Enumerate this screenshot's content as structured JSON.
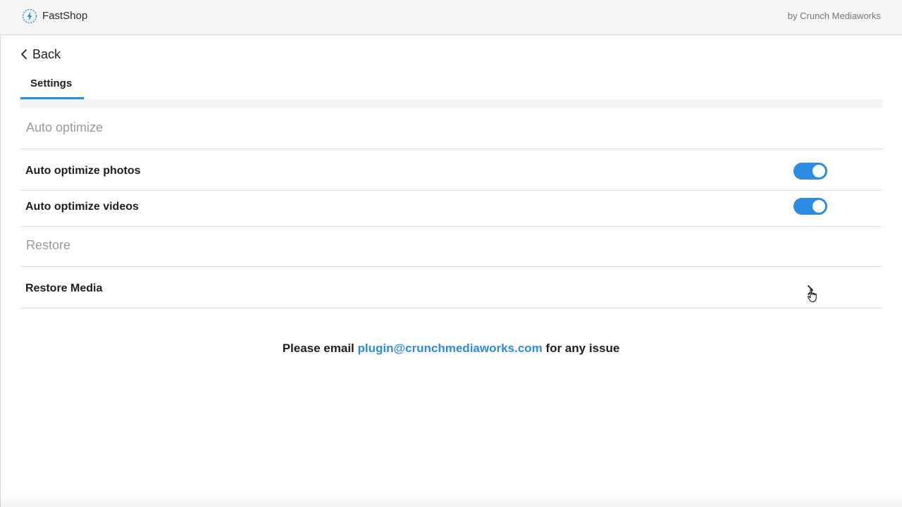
{
  "app": {
    "name": "FastShop",
    "vendor": "by Crunch Mediaworks",
    "accent_color": "#2c8be2",
    "logo_icon": "lightning-bolt-icon"
  },
  "nav": {
    "back_label": "Back",
    "back_icon": "chevron-left-icon"
  },
  "tabs": [
    {
      "label": "Settings",
      "active": true
    }
  ],
  "sections": {
    "auto_optimize": {
      "title": "Auto optimize",
      "rows": [
        {
          "label": "Auto optimize photos",
          "toggle_on": true
        },
        {
          "label": "Auto optimize videos",
          "toggle_on": true
        }
      ]
    },
    "restore": {
      "title": "Restore",
      "rows": [
        {
          "label": "Restore Media",
          "icon": "chevron-right-icon"
        }
      ]
    }
  },
  "footer": {
    "prefix": "Please email",
    "email": "plugin@crunchmediaworks.com",
    "suffix": "for any issue"
  }
}
